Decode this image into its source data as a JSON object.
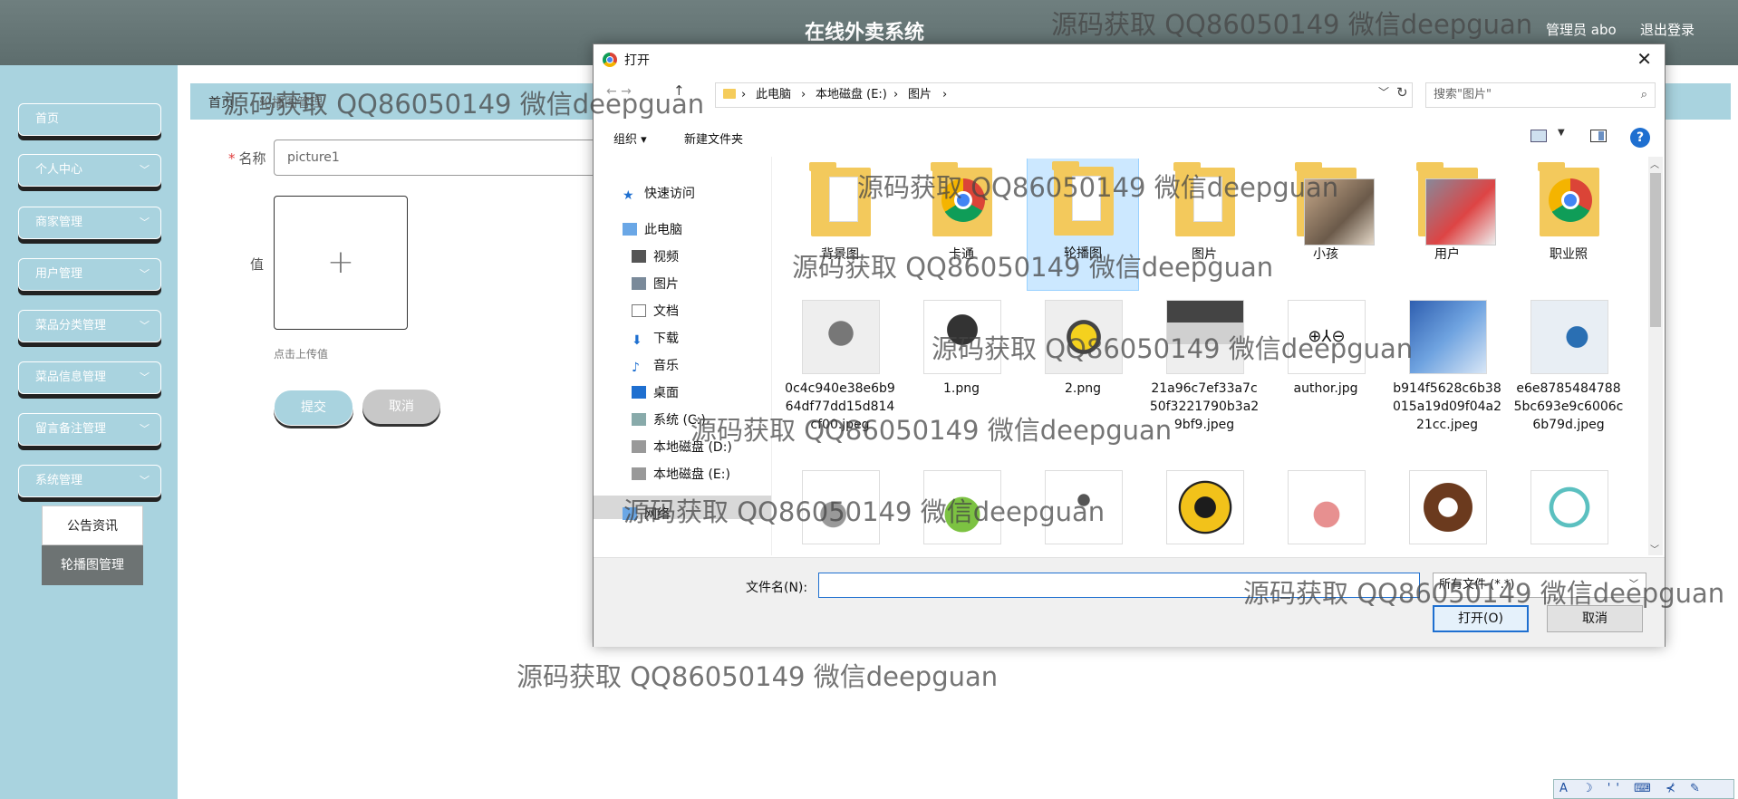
{
  "header": {
    "title": "在线外卖系统",
    "user_label": "管理员 abo",
    "logout_label": "退出登录"
  },
  "sidebar": {
    "items": [
      {
        "label": "首页",
        "has_chevron": false
      },
      {
        "label": "个人中心",
        "has_chevron": true
      },
      {
        "label": "商家管理",
        "has_chevron": true
      },
      {
        "label": "用户管理",
        "has_chevron": true
      },
      {
        "label": "菜品分类管理",
        "has_chevron": true
      },
      {
        "label": "菜品信息管理",
        "has_chevron": true
      },
      {
        "label": "留言备注管理",
        "has_chevron": true
      },
      {
        "label": "系统管理",
        "has_chevron": true
      }
    ],
    "submenu": [
      {
        "label": "公告资讯"
      },
      {
        "label": "轮播图管理"
      }
    ]
  },
  "breadcrumb": {
    "home": "首页",
    "current": "轮播图管理"
  },
  "form": {
    "name_label": "名称",
    "name_value": "picture1",
    "value_label": "值",
    "upload_hint": "点击上传值",
    "submit_label": "提交",
    "cancel_label": "取消"
  },
  "dialog": {
    "title": "打开",
    "address": [
      "此电脑",
      "本地磁盘 (E:)",
      "图片"
    ],
    "search_placeholder": "搜索\"图片\"",
    "toolbar": {
      "organize": "组织",
      "new_folder": "新建文件夹"
    },
    "nav": [
      {
        "label": "快速访问",
        "icon": "star-icon"
      },
      {
        "label": "此电脑",
        "icon": "computer-icon"
      },
      {
        "label": "视频",
        "icon": "video-icon"
      },
      {
        "label": "图片",
        "icon": "pictures-icon"
      },
      {
        "label": "文档",
        "icon": "document-icon"
      },
      {
        "label": "下载",
        "icon": "download-icon"
      },
      {
        "label": "音乐",
        "icon": "music-icon"
      },
      {
        "label": "桌面",
        "icon": "desktop-icon"
      },
      {
        "label": "系统 (C:)",
        "icon": "drive-icon"
      },
      {
        "label": "本地磁盘 (D:)",
        "icon": "drive-icon"
      },
      {
        "label": "本地磁盘 (E:)",
        "icon": "drive-icon"
      },
      {
        "label": "网络",
        "icon": "network-icon"
      }
    ],
    "selected_nav": "本地磁盘 (E:)",
    "files": [
      {
        "name": "背景图",
        "kind": "folder"
      },
      {
        "name": "卡通",
        "kind": "folder-chrome"
      },
      {
        "name": "轮播图",
        "kind": "folder",
        "selected": true
      },
      {
        "name": "图片",
        "kind": "folder"
      },
      {
        "name": "小孩",
        "kind": "folder-photo"
      },
      {
        "name": "用户",
        "kind": "folder-photo"
      },
      {
        "name": "职业照",
        "kind": "folder-chrome"
      },
      {
        "name": "0c4c940e38e6b964df77dd15d814cf00.jpeg",
        "kind": "image"
      },
      {
        "name": "1.png",
        "kind": "image"
      },
      {
        "name": "2.png",
        "kind": "image"
      },
      {
        "name": "21a96c7ef33a7c50f3221790b3a29bf9.jpeg",
        "kind": "image"
      },
      {
        "name": "author.jpg",
        "kind": "image",
        "thumb_text": "⊕⅄⊖"
      },
      {
        "name": "b914f5628c6b38015a19d09f04a221cc.jpeg",
        "kind": "image"
      },
      {
        "name": "e6e87854847885bc693e9c6006c6b79d.jpeg",
        "kind": "image"
      },
      {
        "name": "",
        "kind": "image"
      },
      {
        "name": "",
        "kind": "image"
      },
      {
        "name": "",
        "kind": "image"
      },
      {
        "name": "",
        "kind": "image"
      },
      {
        "name": "",
        "kind": "image"
      },
      {
        "name": "",
        "kind": "image"
      },
      {
        "name": "",
        "kind": "image"
      }
    ],
    "filename_label": "文件名(N):",
    "filename_value": "",
    "filetype_value": "所有文件 (*.*)",
    "open_label": "打开(O)",
    "cancel_label": "取消"
  },
  "watermark_text": "源码获取 QQ86050149 微信deepguan",
  "ime_text": "A ☽ '' ⌨ ⊀ ✎"
}
